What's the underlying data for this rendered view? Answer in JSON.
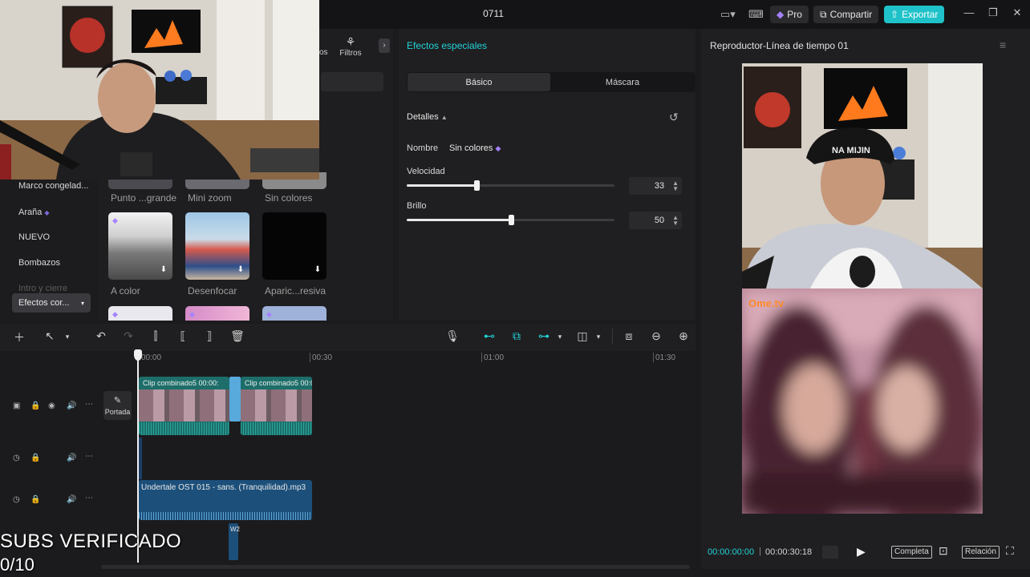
{
  "topbar": {
    "project_title": "0711",
    "pro_label": "Pro",
    "share_label": "Compartir",
    "export_label": "Exportar"
  },
  "media_panel": {
    "filters_tab": "Filtros",
    "cut_tab_fragment": "os",
    "categories": [
      "Marco congelad...",
      "Araña",
      "NUEVO",
      "Bombazos",
      "Intro y cierre"
    ],
    "category_dropdown": "Efectos cor...",
    "effects_row1": [
      "Punto ...grande",
      "Mini zoom",
      "Sin colores"
    ],
    "effects_row2": [
      "A color",
      "Desenfocar",
      "Aparic...resiva"
    ]
  },
  "effects_panel": {
    "title": "Efectos especiales",
    "tabs": [
      "Básico",
      "Máscara"
    ],
    "section_title": "Detalles",
    "name_label": "Nombre",
    "name_value": "Sin colores",
    "speed_label": "Velocidad",
    "speed_value": "33",
    "brightness_label": "Brillo",
    "brightness_value": "50"
  },
  "player": {
    "title": "Reproductor-Línea de tiempo 01",
    "watermark": "Ome.tv",
    "time_current": "00:00:00:00",
    "time_total": "00:00:30:18",
    "full_label": "Completa",
    "ratio_label": "Relación"
  },
  "timeline": {
    "ruler": [
      "00:00",
      "00:30",
      "01:00",
      "01:30"
    ],
    "cover_label": "Portada",
    "clip1_label": "Clip combinado5   00:00:",
    "clip2_label": "Clip combinado5   00:00",
    "audio_label": "Undertale OST 015 - sans. (Tranquilidad).mp3",
    "sfx_label": "W2"
  },
  "overlay": {
    "subs_text": "SUBS VERIFICADO",
    "subs_count": "0/10"
  },
  "colors": {
    "accent": "#1fc2c8",
    "panel_bg": "#1f1f21",
    "app_bg": "#1b1b1d",
    "video_clip": "#1d6e6a",
    "audio_clip": "#1c4f7a"
  }
}
